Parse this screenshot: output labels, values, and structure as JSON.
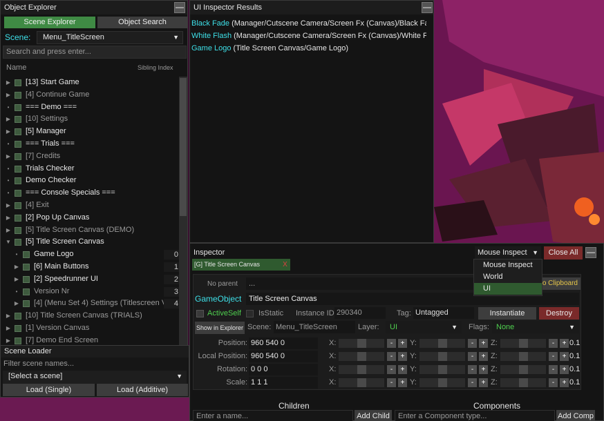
{
  "object_explorer": {
    "title": "Object Explorer",
    "minimize": "—",
    "tab_scene_explorer": "Scene Explorer",
    "tab_object_search": "Object Search",
    "scene_label": "Scene:",
    "scene_value": "Menu_TitleScreen",
    "search_placeholder": "Search and press enter...",
    "col_name": "Name",
    "col_sibling": "Sibling Index",
    "items": [
      {
        "label": "[13] Start Game",
        "indent": 0,
        "arrow": "▶",
        "dim": false,
        "sib": ""
      },
      {
        "label": "[4] Continue Game",
        "indent": 0,
        "arrow": "▶",
        "dim": true,
        "sib": ""
      },
      {
        "label": "=== Demo ===",
        "indent": 0,
        "arrow": "•",
        "dim": false,
        "sib": ""
      },
      {
        "label": "[10] Settings",
        "indent": 0,
        "arrow": "▶",
        "dim": true,
        "sib": ""
      },
      {
        "label": "[5] Manager",
        "indent": 0,
        "arrow": "▶",
        "dim": false,
        "sib": ""
      },
      {
        "label": "=== Trials ===",
        "indent": 0,
        "arrow": "•",
        "dim": false,
        "sib": ""
      },
      {
        "label": "[7] Credits",
        "indent": 0,
        "arrow": "▶",
        "dim": true,
        "sib": ""
      },
      {
        "label": "Trials Checker",
        "indent": 0,
        "arrow": "•",
        "dim": false,
        "sib": ""
      },
      {
        "label": "Demo Checker",
        "indent": 0,
        "arrow": "•",
        "dim": false,
        "sib": ""
      },
      {
        "label": "=== Console Specials ===",
        "indent": 0,
        "arrow": "•",
        "dim": false,
        "sib": ""
      },
      {
        "label": "[4] Exit",
        "indent": 0,
        "arrow": "▶",
        "dim": true,
        "sib": ""
      },
      {
        "label": "[2] Pop Up Canvas",
        "indent": 0,
        "arrow": "▶",
        "dim": false,
        "sib": ""
      },
      {
        "label": "[5] Title Screen Canvas (DEMO)",
        "indent": 0,
        "arrow": "▶",
        "dim": true,
        "sib": ""
      },
      {
        "label": "[5] Title Screen Canvas",
        "indent": 0,
        "arrow": "▼",
        "dim": false,
        "sib": ""
      },
      {
        "label": "Game Logo",
        "indent": 1,
        "arrow": "•",
        "dim": false,
        "sib": "0"
      },
      {
        "label": "[6] Main Buttons",
        "indent": 1,
        "arrow": "▶",
        "dim": false,
        "sib": "1"
      },
      {
        "label": "[2] Speedrunner UI",
        "indent": 1,
        "arrow": "▶",
        "dim": false,
        "sib": "2"
      },
      {
        "label": "Version Nr",
        "indent": 1,
        "arrow": "•",
        "dim": true,
        "sib": "3"
      },
      {
        "label": "[4] (Menu Set 4) Settings (Titlescreen V",
        "indent": 1,
        "arrow": "▶",
        "dim": true,
        "sib": "4"
      },
      {
        "label": "[10] Title Screen Canvas (TRIALS)",
        "indent": 0,
        "arrow": "▶",
        "dim": true,
        "sib": ""
      },
      {
        "label": "[1] Version Canvas",
        "indent": 0,
        "arrow": "▶",
        "dim": true,
        "sib": ""
      },
      {
        "label": "[7] Demo End Screen",
        "indent": 0,
        "arrow": "▶",
        "dim": true,
        "sib": ""
      }
    ]
  },
  "scene_loader": {
    "title": "Scene Loader",
    "filter_placeholder": "Filter scene names...",
    "select_value": "[Select a scene]",
    "load_single": "Load (Single)",
    "load_additive": "Load (Additive)"
  },
  "ui_inspector_results": {
    "title": "UI Inspector Results",
    "minimize": "—",
    "results": [
      {
        "name": "Black Fade",
        "path": " (Manager/Cutscene Camera/Screen Fx (Canvas)/Black Fade)"
      },
      {
        "name": "White Flash",
        "path": " (Manager/Cutscene Camera/Screen Fx (Canvas)/White Flash"
      },
      {
        "name": "Game Logo",
        "path": " (Title Screen Canvas/Game Logo)"
      }
    ]
  },
  "inspector": {
    "title": "Inspector",
    "mode_value": "Mouse Inspect",
    "mode_options": [
      "Mouse Inspect",
      "World",
      "UI"
    ],
    "close_all": "Close All",
    "minimize": "—",
    "tab_label": "[G] Title Screen Canvas",
    "tab_close": "X",
    "no_parent": "No parent",
    "parent_path": "...",
    "copy_clipboard": "o Clipboard",
    "gameobject_label": "GameObject",
    "name_value": "Title Screen Canvas",
    "active_self": "ActiveSelf",
    "is_static": "IsStatic",
    "instance_id_label": "Instance ID:",
    "instance_id": "290340",
    "tag_label": "Tag:",
    "tag_value": "Untagged",
    "instantiate": "Instantiate",
    "destroy": "Destroy",
    "show_in_explorer": "Show in Explorer",
    "scene_label": "Scene:",
    "scene_value": "Menu_TitleScreen",
    "layer_label": "Layer:",
    "layer_value": "UI",
    "flags_label": "Flags:",
    "flags_value": "None",
    "transforms": [
      {
        "label": "Position:",
        "value": "960 540 0"
      },
      {
        "label": "Local Position:",
        "value": "960 540 0"
      },
      {
        "label": "Rotation:",
        "value": "0 0 0"
      },
      {
        "label": "Scale:",
        "value": "1 1 1"
      }
    ],
    "axis_x": "X:",
    "axis_y": "Y:",
    "axis_z": "Z:",
    "minus": "-",
    "plus": "+",
    "step": "0.1",
    "children_title": "Children",
    "components_title": "Components",
    "child_placeholder": "Enter a name...",
    "add_child": "Add Child",
    "component_placeholder": "Enter a Component type...",
    "add_comp": "Add Comp"
  },
  "colors": {
    "accent_cyan": "#3ee0e8",
    "accent_green": "#4fd04f",
    "tab_active": "#3f8a44",
    "destroy_red": "#7a2a2a"
  }
}
